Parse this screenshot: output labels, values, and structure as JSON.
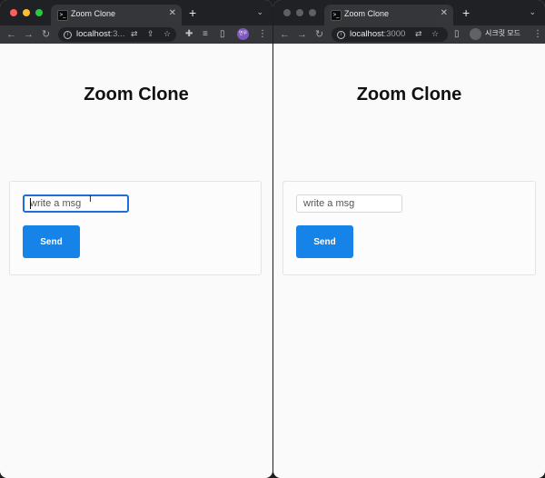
{
  "colors": {
    "accent": "#1683e8",
    "focus_ring": "#1d6fd6",
    "chrome_dark": "#202124"
  },
  "left_window": {
    "tab_title": "Zoom Clone",
    "url_host": "localhost",
    "url_rest": ":3...",
    "profile_initials": "연우",
    "page_title": "Zoom Clone",
    "input_placeholder": "write a msg",
    "send_label": "Send"
  },
  "right_window": {
    "tab_title": "Zoom Clone",
    "url_host": "localhost",
    "url_rest": ":3000",
    "incognito_label": "시크릿 모드",
    "page_title": "Zoom Clone",
    "input_placeholder": "write a msg",
    "send_label": "Send"
  }
}
